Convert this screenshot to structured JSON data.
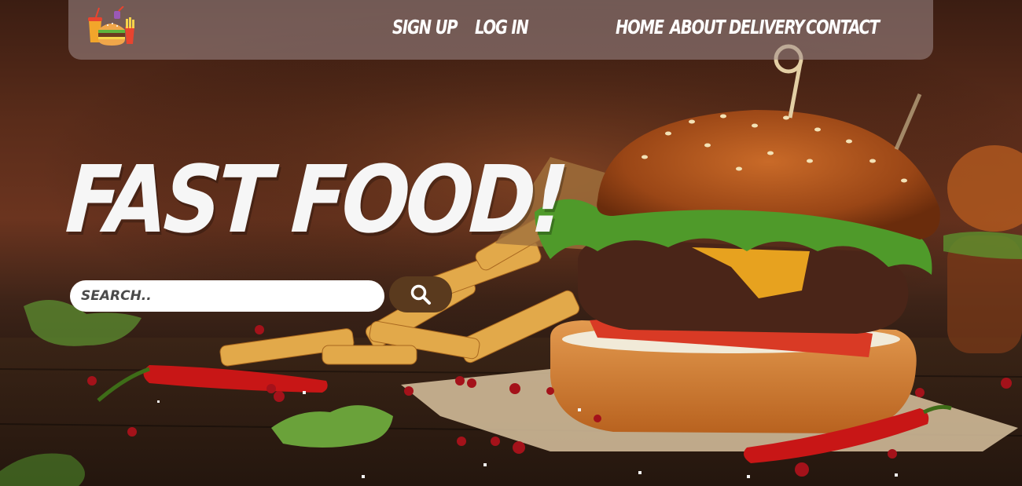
{
  "nav": {
    "logo_icon": "fast-food-logo-icon",
    "sign_up": "SIGN UP",
    "log_in": "LOG IN",
    "home": "HOME",
    "about": "ABOUT",
    "delivery": "DELIVERY",
    "contact": "CONTACT"
  },
  "hero": {
    "headline": "FAST FOOD!",
    "background_image": "burger-and-fries-on-wooden-table"
  },
  "search": {
    "placeholder": "SEARCH..",
    "value": "",
    "button_icon": "search-icon"
  },
  "colors": {
    "nav_bg": "#a08c8c",
    "headline": "#f6f6f6",
    "search_button": "#5a3a1e",
    "text_light": "#ffffff"
  }
}
